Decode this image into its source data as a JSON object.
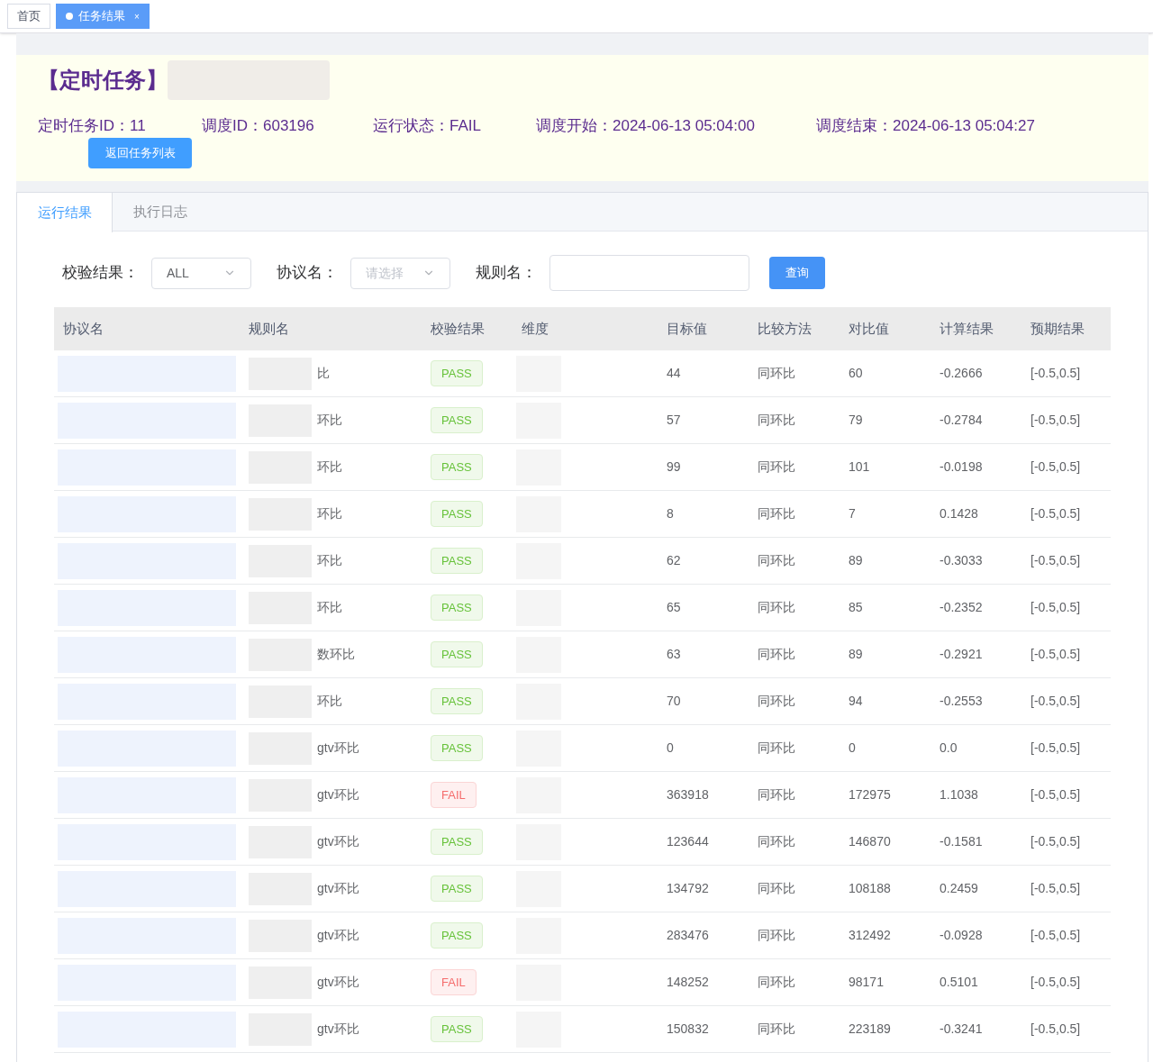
{
  "top_tabs": [
    {
      "label": "首页",
      "selected": false
    },
    {
      "label": "任务结果",
      "selected": true,
      "close": "×"
    }
  ],
  "task": {
    "title": "【定时任务】",
    "fields": [
      {
        "label": "定时任务ID：",
        "value": "11"
      },
      {
        "label": "调度ID：",
        "value": "603196"
      },
      {
        "label": "运行状态：",
        "value": "FAIL"
      },
      {
        "label": "调度开始：",
        "value": "2024-06-13 05:04:00"
      },
      {
        "label": "调度结束：",
        "value": "2024-06-13 05:04:27"
      }
    ],
    "back_button": "返回任务列表"
  },
  "tabs": [
    {
      "label": "运行结果",
      "selected": true
    },
    {
      "label": "执行日志",
      "selected": false
    }
  ],
  "filters": {
    "result": {
      "label": "校验结果：",
      "value": "ALL"
    },
    "protocol": {
      "label": "协议名：",
      "placeholder": "请选择"
    },
    "rule": {
      "label": "规则名："
    },
    "query_button": "查询"
  },
  "table": {
    "columns": [
      "协议名",
      "规则名",
      "校验结果",
      "维度",
      "目标值",
      "比较方法",
      "对比值",
      "计算结果",
      "预期结果"
    ],
    "rows": [
      {
        "rule": "比",
        "result": {
          "label": "PASS",
          "kind": "pass"
        },
        "target": "44",
        "method": "同环比",
        "compare": "60",
        "calc": "-0.2666",
        "expected": "[-0.5,0.5]"
      },
      {
        "rule": "环比",
        "result": {
          "label": "PASS",
          "kind": "pass"
        },
        "target": "57",
        "method": "同环比",
        "compare": "79",
        "calc": "-0.2784",
        "expected": "[-0.5,0.5]"
      },
      {
        "rule": "环比",
        "result": {
          "label": "PASS",
          "kind": "pass"
        },
        "target": "99",
        "method": "同环比",
        "compare": "101",
        "calc": "-0.0198",
        "expected": "[-0.5,0.5]"
      },
      {
        "rule": "环比",
        "result": {
          "label": "PASS",
          "kind": "pass"
        },
        "target": "8",
        "method": "同环比",
        "compare": "7",
        "calc": "0.1428",
        "expected": "[-0.5,0.5]"
      },
      {
        "rule": "环比",
        "result": {
          "label": "PASS",
          "kind": "pass"
        },
        "target": "62",
        "method": "同环比",
        "compare": "89",
        "calc": "-0.3033",
        "expected": "[-0.5,0.5]"
      },
      {
        "rule": "环比",
        "result": {
          "label": "PASS",
          "kind": "pass"
        },
        "target": "65",
        "method": "同环比",
        "compare": "85",
        "calc": "-0.2352",
        "expected": "[-0.5,0.5]"
      },
      {
        "rule": "数环比",
        "result": {
          "label": "PASS",
          "kind": "pass"
        },
        "target": "63",
        "method": "同环比",
        "compare": "89",
        "calc": "-0.2921",
        "expected": "[-0.5,0.5]"
      },
      {
        "rule": "环比",
        "result": {
          "label": "PASS",
          "kind": "pass"
        },
        "target": "70",
        "method": "同环比",
        "compare": "94",
        "calc": "-0.2553",
        "expected": "[-0.5,0.5]"
      },
      {
        "rule": "gtv环比",
        "result": {
          "label": "PASS",
          "kind": "pass"
        },
        "target": "0",
        "method": "同环比",
        "compare": "0",
        "calc": "0.0",
        "expected": "[-0.5,0.5]"
      },
      {
        "rule": "gtv环比",
        "result": {
          "label": "FAIL",
          "kind": "fail"
        },
        "target": "363918",
        "method": "同环比",
        "compare": "172975",
        "calc": "1.1038",
        "expected": "[-0.5,0.5]"
      },
      {
        "rule": "gtv环比",
        "result": {
          "label": "PASS",
          "kind": "pass"
        },
        "target": "123644",
        "method": "同环比",
        "compare": "146870",
        "calc": "-0.1581",
        "expected": "[-0.5,0.5]"
      },
      {
        "rule": "gtv环比",
        "result": {
          "label": "PASS",
          "kind": "pass"
        },
        "target": "134792",
        "method": "同环比",
        "compare": "108188",
        "calc": "0.2459",
        "expected": "[-0.5,0.5]"
      },
      {
        "rule": "gtv环比",
        "result": {
          "label": "PASS",
          "kind": "pass"
        },
        "target": "283476",
        "method": "同环比",
        "compare": "312492",
        "calc": "-0.0928",
        "expected": "[-0.5,0.5]"
      },
      {
        "rule": "gtv环比",
        "result": {
          "label": "FAIL",
          "kind": "fail"
        },
        "target": "148252",
        "method": "同环比",
        "compare": "98171",
        "calc": "0.5101",
        "expected": "[-0.5,0.5]"
      },
      {
        "rule": "gtv环比",
        "result": {
          "label": "PASS",
          "kind": "pass"
        },
        "target": "150832",
        "method": "同环比",
        "compare": "223189",
        "calc": "-0.3241",
        "expected": "[-0.5,0.5]"
      }
    ]
  }
}
